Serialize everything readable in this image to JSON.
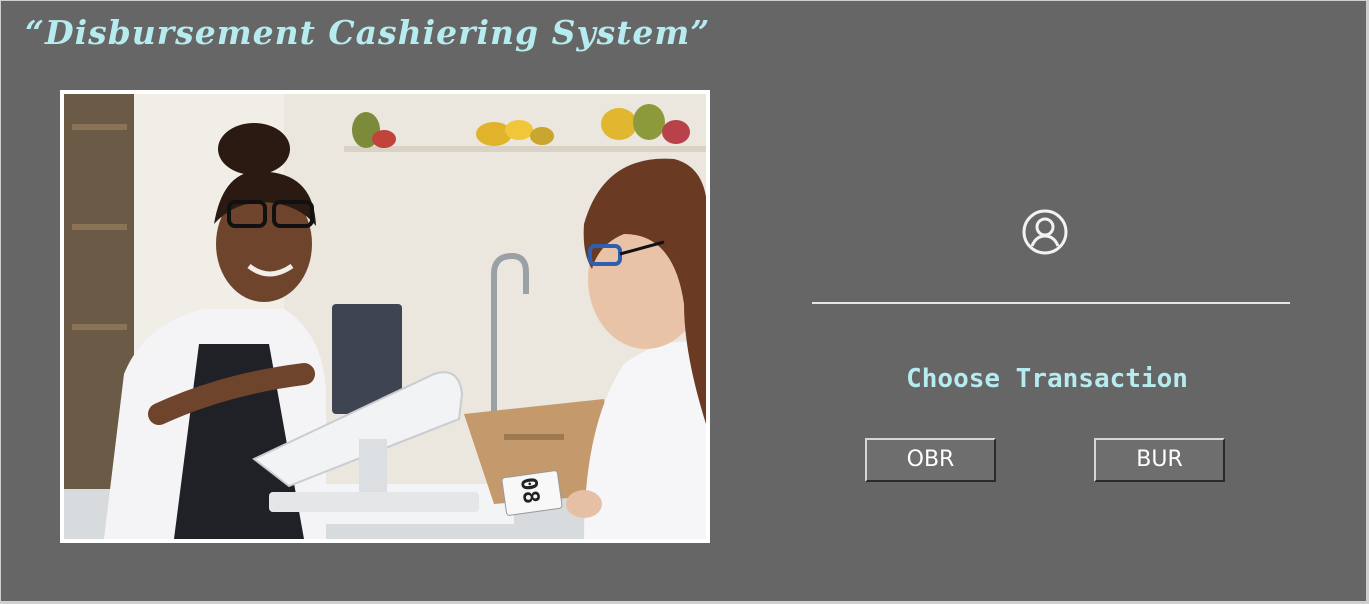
{
  "window": {
    "title": "“Disbursement Cashiering System”"
  },
  "photo": {
    "subject": "cashier-assisting-customer-photo",
    "receipt_text": "08"
  },
  "login": {
    "icon": "user-circle-icon"
  },
  "transaction": {
    "label": "Choose Transaction",
    "buttons": [
      {
        "label": "OBR"
      },
      {
        "label": "BUR"
      }
    ]
  },
  "colors": {
    "background": "#666666",
    "accent_text": "#b6ecef",
    "button_face": "#6e6e6e",
    "divider": "#e6e6e6"
  }
}
